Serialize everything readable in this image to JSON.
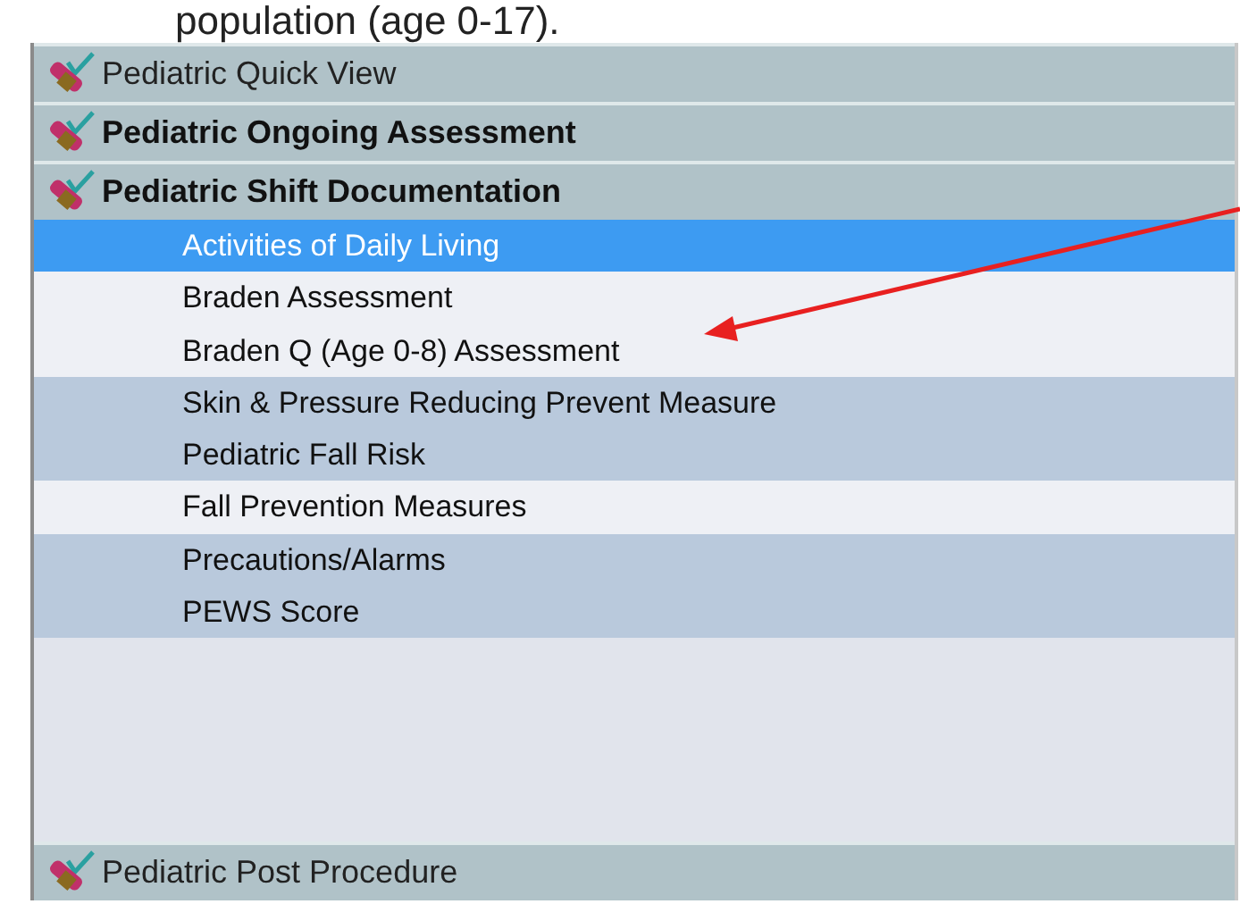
{
  "caption": "population (age 0-17).",
  "sections": [
    {
      "title": "Pediatric Quick View",
      "bold": false
    },
    {
      "title": "Pediatric Ongoing Assessment",
      "bold": true
    },
    {
      "title": "Pediatric Shift Documentation",
      "bold": true,
      "items": [
        {
          "label": "Activities of Daily Living",
          "selected": true,
          "shaded": false
        },
        {
          "label": "Braden Assessment",
          "selected": false,
          "shaded": false
        },
        {
          "label": "Braden Q (Age 0-8) Assessment",
          "selected": false,
          "shaded": false
        },
        {
          "label": "Skin & Pressure Reducing Prevent Measure",
          "selected": false,
          "shaded": true
        },
        {
          "label": "Pediatric Fall Risk",
          "selected": false,
          "shaded": true
        },
        {
          "label": "Fall Prevention Measures",
          "selected": false,
          "shaded": false
        },
        {
          "label": "Precautions/Alarms",
          "selected": false,
          "shaded": true
        },
        {
          "label": "PEWS Score",
          "selected": false,
          "shaded": true
        }
      ]
    }
  ],
  "footer_section": {
    "title": "Pediatric Post Procedure",
    "bold": false
  }
}
